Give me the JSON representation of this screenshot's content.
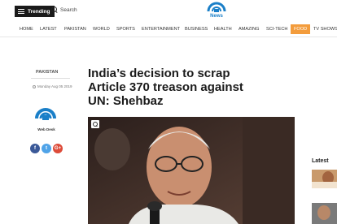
{
  "header": {
    "trending_label": "Trending",
    "search_placeholder": "Search",
    "logo_text": "News"
  },
  "nav": {
    "items": [
      {
        "label": "HOME"
      },
      {
        "label": "LATEST"
      },
      {
        "label": "PAKISTAN"
      },
      {
        "label": "WORLD"
      },
      {
        "label": "SPORTS"
      },
      {
        "label": "ENTERTAINMENT"
      },
      {
        "label": "BUSINESS"
      },
      {
        "label": "HEALTH"
      },
      {
        "label": "AMAZING"
      },
      {
        "label": "SCI-TECH"
      },
      {
        "label": "FOOD"
      },
      {
        "label": "TV SHOWS"
      }
    ],
    "active_label": "FOOD",
    "active_color": "#f39c3c"
  },
  "article": {
    "section": "PAKISTAN",
    "date": "Monday Aug 05 2019",
    "author": "Web Desk",
    "headline": "India’s decision to scrap Article 370 treason against UN: Shehbaz"
  },
  "share": {
    "facebook": "f",
    "twitter": "t",
    "googleplus": "G+"
  },
  "sidebar": {
    "latest_title": "Latest"
  },
  "colors": {
    "brand_blue": "#1a7fc8",
    "brand_orange": "#f39c3c",
    "facebook": "#3b5998",
    "twitter": "#4fa3e8",
    "googleplus": "#dd4b39"
  }
}
